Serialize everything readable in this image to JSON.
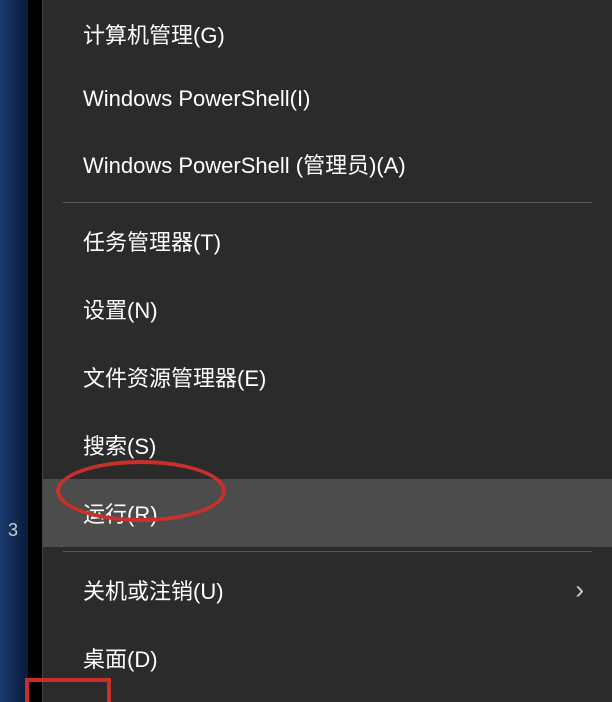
{
  "pageNumber": "3",
  "menu": {
    "items": [
      {
        "label": "计算机管理(G)"
      },
      {
        "label": "Windows PowerShell(I)"
      },
      {
        "label": "Windows PowerShell (管理员)(A)"
      },
      {
        "label": "任务管理器(T)"
      },
      {
        "label": "设置(N)"
      },
      {
        "label": "文件资源管理器(E)"
      },
      {
        "label": "搜索(S)"
      },
      {
        "label": "运行(R)"
      },
      {
        "label": "关机或注销(U)"
      },
      {
        "label": "桌面(D)"
      }
    ]
  }
}
